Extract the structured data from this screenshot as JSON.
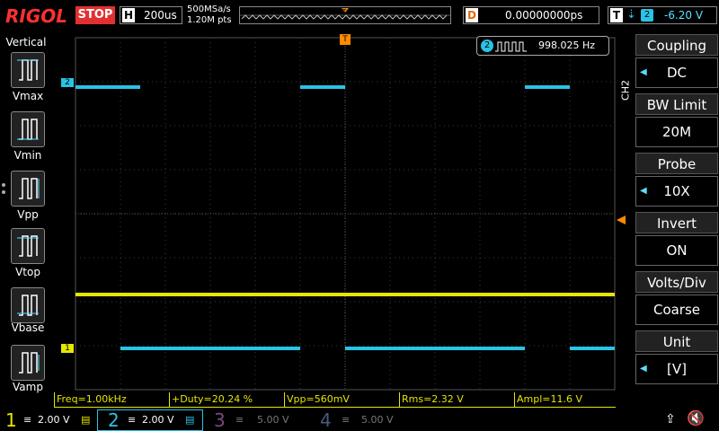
{
  "topbar": {
    "logo": "RIGOL",
    "run_state": "STOP",
    "horizontal_label": "H",
    "timebase": "200us",
    "sample_rate": "500MSa/s",
    "memory_depth": "1.20M pts",
    "delay_label": "D",
    "delay_value": "0.00000000ps",
    "trigger_label": "T",
    "trigger_channel": "2",
    "trigger_level": "-6.20 V"
  },
  "left_panel": {
    "title": "Vertical",
    "buttons": [
      {
        "label": "Vmax"
      },
      {
        "label": "Vmin"
      },
      {
        "label": "Vpp"
      },
      {
        "label": "Vtop"
      },
      {
        "label": "Vbase"
      },
      {
        "label": "Vamp"
      }
    ]
  },
  "frequency_counter": {
    "channel": "2",
    "value": "998.025 Hz"
  },
  "markers": {
    "ch2_marker": "2",
    "ch1_marker": "1",
    "trigger_marker": "T"
  },
  "right_panel": {
    "channel_tag": "CH2",
    "menus": [
      {
        "title": "Coupling",
        "value": "DC",
        "has_arrow": true
      },
      {
        "title": "BW Limit",
        "value": "20M",
        "has_arrow": false
      },
      {
        "title": "Probe",
        "value": "10X",
        "has_arrow": true
      },
      {
        "title": "Invert",
        "value": "ON",
        "has_arrow": false
      },
      {
        "title": "Volts/Div",
        "value": "Coarse",
        "has_arrow": false
      },
      {
        "title": "Unit",
        "value": "[V]",
        "has_arrow": true
      }
    ]
  },
  "measurements": [
    {
      "text": "Freq=1.00kHz"
    },
    {
      "text": "+Duty=20.24 %"
    },
    {
      "text": "Vpp=560mV"
    },
    {
      "text": "Rms=2.32 V"
    },
    {
      "text": "Ampl=11.6 V"
    }
  ],
  "channels": [
    {
      "num": "1",
      "scale": "2.00 V",
      "color": "#e6e600"
    },
    {
      "num": "2",
      "scale": "2.00 V",
      "color": "#29c3e6"
    },
    {
      "num": "3",
      "scale": "5.00 V",
      "color": "#7a4a7a"
    },
    {
      "num": "4",
      "scale": "5.00 V",
      "color": "#4a5a7a"
    }
  ],
  "colors": {
    "ch1": "#e6e600",
    "ch2": "#29c3e6",
    "trigger": "#ff8a00",
    "stop": "#e23030",
    "grid": "#3a3a3a"
  }
}
